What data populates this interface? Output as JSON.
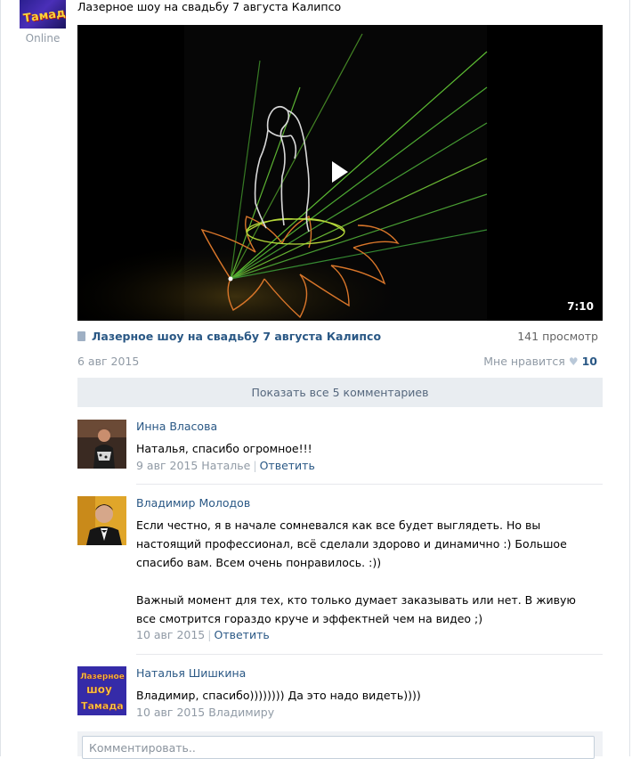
{
  "author": {
    "avatar_logo": "Тамада",
    "status": "Online"
  },
  "post": {
    "text": "Лазерное шоу на свадьбу 7 августа Калипсо",
    "video": {
      "duration": "7:10",
      "title": "Лазерное шоу на свадьбу 7 августа Калипсо",
      "views": "141 просмотр",
      "icon": "video-file-icon"
    },
    "date": "6 авг 2015",
    "like_label": "Мне нравится",
    "like_icon": "heart-icon",
    "like_count": "10"
  },
  "show_all_comments": "Показать все 5 комментариев",
  "comments": [
    {
      "author": "Инна Власова",
      "text": "Наталья, спасибо огромное!!!",
      "date": "9 авг 2015",
      "reply_to": "Наталье",
      "reply_label": "Ответить"
    },
    {
      "author": "Владимир Молодов",
      "text": "Если честно, я в начале сомневался как все будет выглядеть. Но вы настоящий профессионал, всё сделали здорово и динамично :) Большое спасибо вам. Всем очень понравилось. :))\n\nВажный момент для тех, кто только думает заказывать или нет. В живую все смотрится гораздо круче и эффектней чем на видео ;)",
      "date": "10 авг 2015",
      "reply_label": "Ответить"
    },
    {
      "author": "Наталья Шишкина",
      "avatar_logo": [
        "Лазерное",
        "шоу",
        "Тамада"
      ],
      "text": "Владимир, спасибо)))))))) Да это надо видеть))))",
      "date": "10 авг 2015",
      "reply_to": "Владимиру"
    }
  ],
  "reply_box": {
    "placeholder": "Комментировать.."
  },
  "colors": {
    "link": "#2a5885",
    "muted": "#909aa5",
    "show_all_bg": "#e9edf1"
  }
}
